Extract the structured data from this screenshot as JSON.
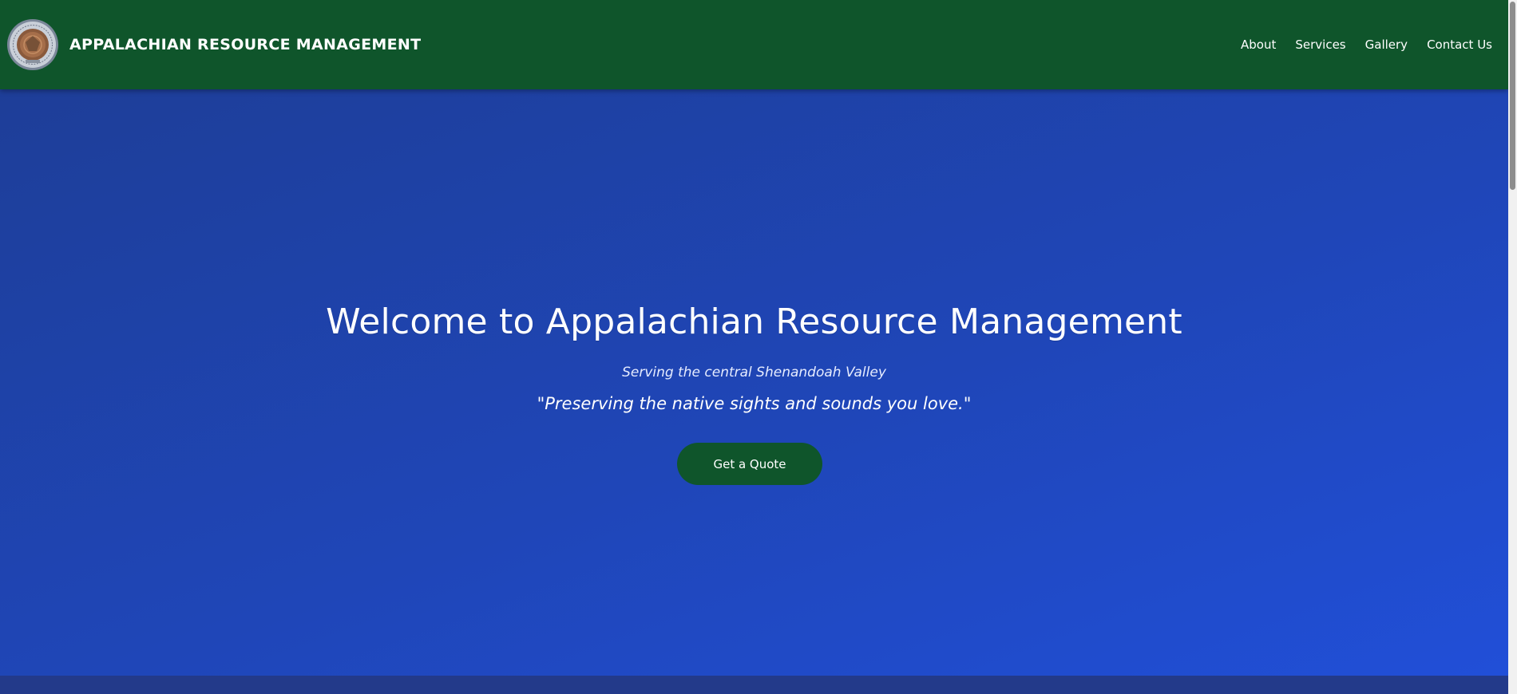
{
  "header": {
    "brand_name": "APPALACHIAN RESOURCE MANAGEMENT",
    "logo_icon": "company-seal-logo",
    "nav": [
      {
        "label": "About"
      },
      {
        "label": "Services"
      },
      {
        "label": "Gallery"
      },
      {
        "label": "Contact Us"
      }
    ]
  },
  "hero": {
    "title": "Welcome to Appalachian Resource Management",
    "subtitle": "Serving the central Shenandoah Valley",
    "quote": "\"Preserving the native sights and sounds you love.\"",
    "cta_label": "Get a Quote"
  },
  "colors": {
    "header_bg": "#0f552b",
    "hero_bg_start": "#1e3e98",
    "hero_bg_end": "#214fd8",
    "button_bg": "#0f552b",
    "text": "#ffffff"
  }
}
